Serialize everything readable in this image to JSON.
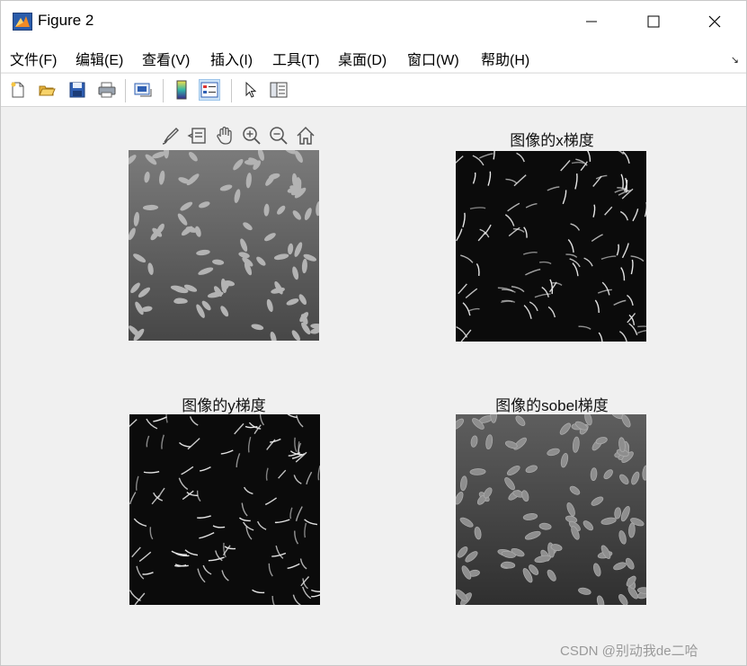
{
  "window": {
    "title": "Figure 2"
  },
  "menu": {
    "items": [
      "文件(F)",
      "编辑(E)",
      "查看(V)",
      "插入(I)",
      "工具(T)",
      "桌面(D)",
      "窗口(W)",
      "帮助(H)"
    ]
  },
  "toolbar": {
    "buttons": [
      "new-figure-icon",
      "open-file-icon",
      "save-icon",
      "print-icon",
      "link-plot-icon",
      "colorbar-icon",
      "legend-icon",
      "edit-plot-cursor-icon",
      "property-inspector-icon"
    ]
  },
  "axes_toolbar": [
    "brush-icon",
    "datatip-icon",
    "pan-hand-icon",
    "zoom-in-icon",
    "zoom-out-icon",
    "home-icon"
  ],
  "panels": [
    {
      "title": "",
      "image": "original rice grain image"
    },
    {
      "title": "图像的x梯度",
      "image": "x gradient"
    },
    {
      "title": "图像的y梯度",
      "image": "y gradient"
    },
    {
      "title": "图像的sobel梯度",
      "image": "sobel gradient"
    }
  ],
  "watermark": "CSDN @别动我de二哈",
  "colors": {
    "matlab_icon": "#2a5caa",
    "menu_bg": "#ffffff",
    "figure_bg": "#f0f0f0"
  }
}
